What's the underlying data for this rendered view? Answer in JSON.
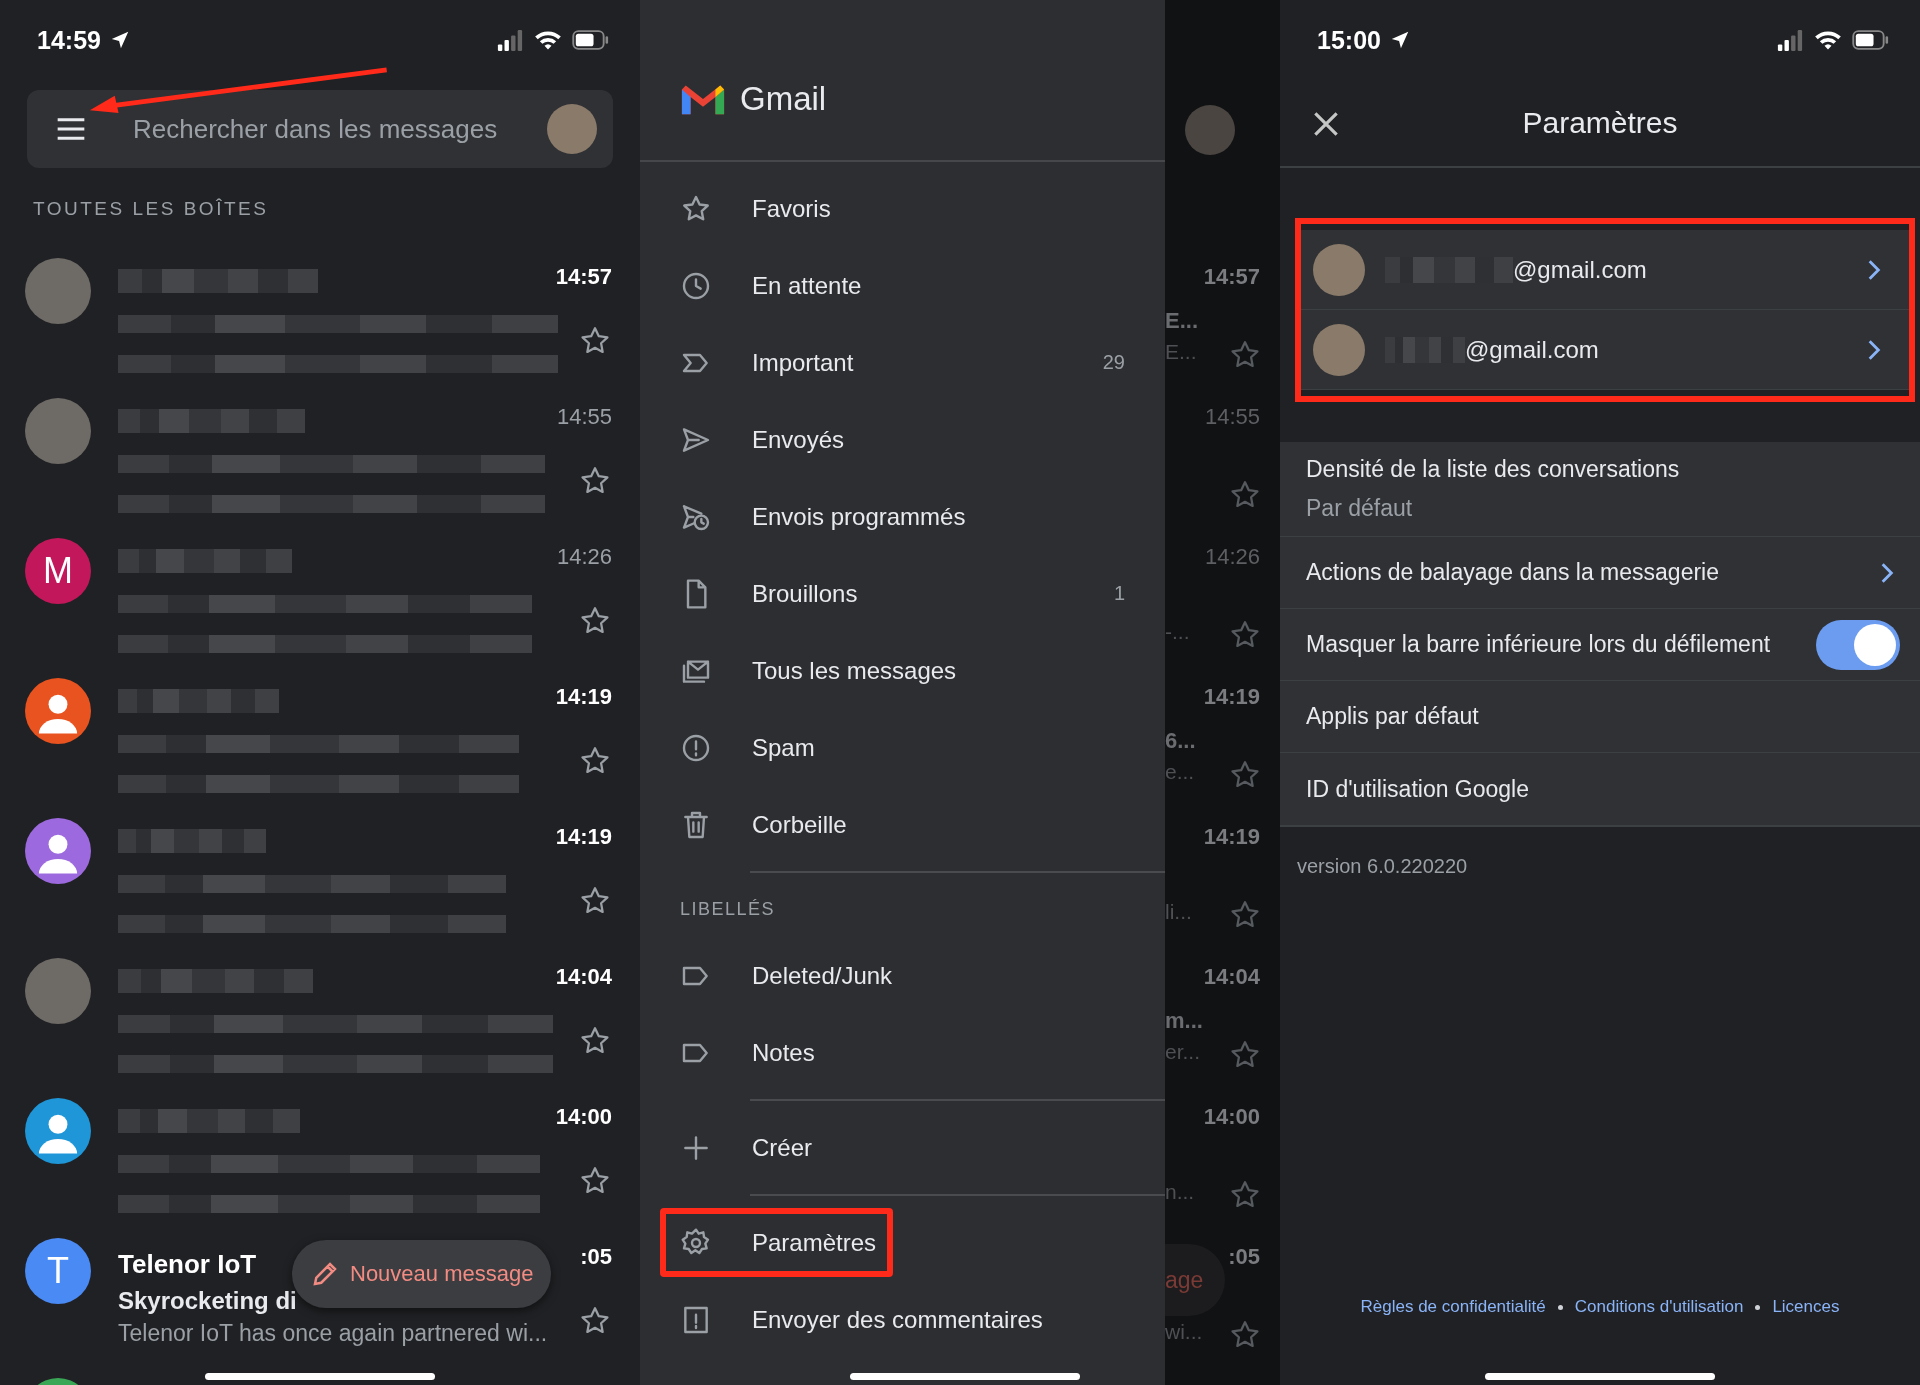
{
  "inbox": {
    "status_time": "14:59",
    "search": {
      "placeholder": "Rechercher dans les messages"
    },
    "section_title": "TOUTES LES BOÎTES",
    "messages": [
      {
        "avatar": {
          "kind": "photo"
        },
        "time": "14:57",
        "unread": true
      },
      {
        "avatar": {
          "kind": "photo"
        },
        "time": "14:55",
        "unread": false
      },
      {
        "avatar": {
          "kind": "letter",
          "letter": "M",
          "color": "#c2185b"
        },
        "time": "14:26",
        "unread": false
      },
      {
        "avatar": {
          "kind": "person",
          "color": "#e8531f"
        },
        "time": "14:19",
        "unread": true
      },
      {
        "avatar": {
          "kind": "person",
          "color": "#9c6ade"
        },
        "time": "14:19",
        "unread": true
      },
      {
        "avatar": {
          "kind": "photo"
        },
        "time": "14:04",
        "unread": true
      },
      {
        "avatar": {
          "kind": "person",
          "color": "#1e96d8"
        },
        "time": "14:00",
        "unread": true
      },
      {
        "avatar": {
          "kind": "letter",
          "letter": "T",
          "color": "#4a8af4"
        },
        "time": ":05",
        "unread": true,
        "sender": "Telenor IoT",
        "subject": "Skyrocketing di",
        "snippet": "Telenor IoT has once again partnered wi..."
      },
      {
        "avatar": {
          "kind": "blank",
          "color": "#3aa757"
        }
      }
    ],
    "compose_button": {
      "label": "Nouveau message"
    }
  },
  "drawer": {
    "title": "Gmail",
    "groups": [
      {
        "items": [
          {
            "label": "Favoris",
            "highlighted": false
          },
          {
            "label": "En attente",
            "highlighted": false
          },
          {
            "label": "Important",
            "count": "29",
            "highlighted": false
          },
          {
            "label": "Envoyés",
            "highlighted": false
          },
          {
            "label": "Envois programmés",
            "highlighted": false
          },
          {
            "label": "Brouillons",
            "count": "1",
            "highlighted": false
          },
          {
            "label": "Tous les messages",
            "highlighted": false
          },
          {
            "label": "Spam",
            "highlighted": false
          },
          {
            "label": "Corbeille",
            "highlighted": false
          }
        ]
      },
      {
        "title": "LIBELLÉS",
        "items": [
          {
            "label": "Deleted/Junk",
            "highlighted": false
          },
          {
            "label": "Notes",
            "highlighted": false
          }
        ]
      },
      {
        "items": [
          {
            "label": "Créer",
            "highlighted": false
          }
        ]
      },
      {
        "items": [
          {
            "label": "Paramètres",
            "highlighted": true
          },
          {
            "label": "Envoyer des commentaires",
            "highlighted": false
          }
        ]
      }
    ],
    "backdrop": {
      "rows": [
        {
          "time": "14:57",
          "unread": true,
          "subject": "E...",
          "snippet": "E..."
        },
        {
          "time": "14:55",
          "unread": false
        },
        {
          "time": "14:26",
          "unread": false,
          "snippet": "-..."
        },
        {
          "time": "14:19",
          "unread": true,
          "subject": "6...",
          "snippet": "e..."
        },
        {
          "time": "14:19",
          "unread": true,
          "snippet": "li..."
        },
        {
          "time": "14:04",
          "unread": true,
          "subject": "m...",
          "snippet": "er..."
        },
        {
          "time": "14:00",
          "unread": true,
          "snippet": "n..."
        },
        {
          "time": ":05",
          "unread": true,
          "snippet": "wi..."
        }
      ],
      "compose_fragment": "age"
    }
  },
  "settings": {
    "status_time": "15:00",
    "title": "Paramètres",
    "accounts_highlighted": true,
    "accounts": [
      {
        "email": "@gmail.com"
      },
      {
        "email": "@gmail.com"
      }
    ],
    "items": [
      {
        "kind": "value",
        "label": "Densité de la liste des conversations",
        "value": "Par défaut"
      },
      {
        "kind": "link",
        "label": "Actions de balayage dans la messagerie"
      },
      {
        "kind": "toggle",
        "label": "Masquer la barre inférieure lors du défilement",
        "on": true
      },
      {
        "kind": "plain",
        "label": "Applis par défaut"
      },
      {
        "kind": "plain",
        "label": "ID d'utilisation Google"
      }
    ],
    "version": "version 6.0.220220",
    "footer_links": [
      "Règles de confidentialité",
      "Conditions d'utilisation",
      "Licences"
    ]
  }
}
